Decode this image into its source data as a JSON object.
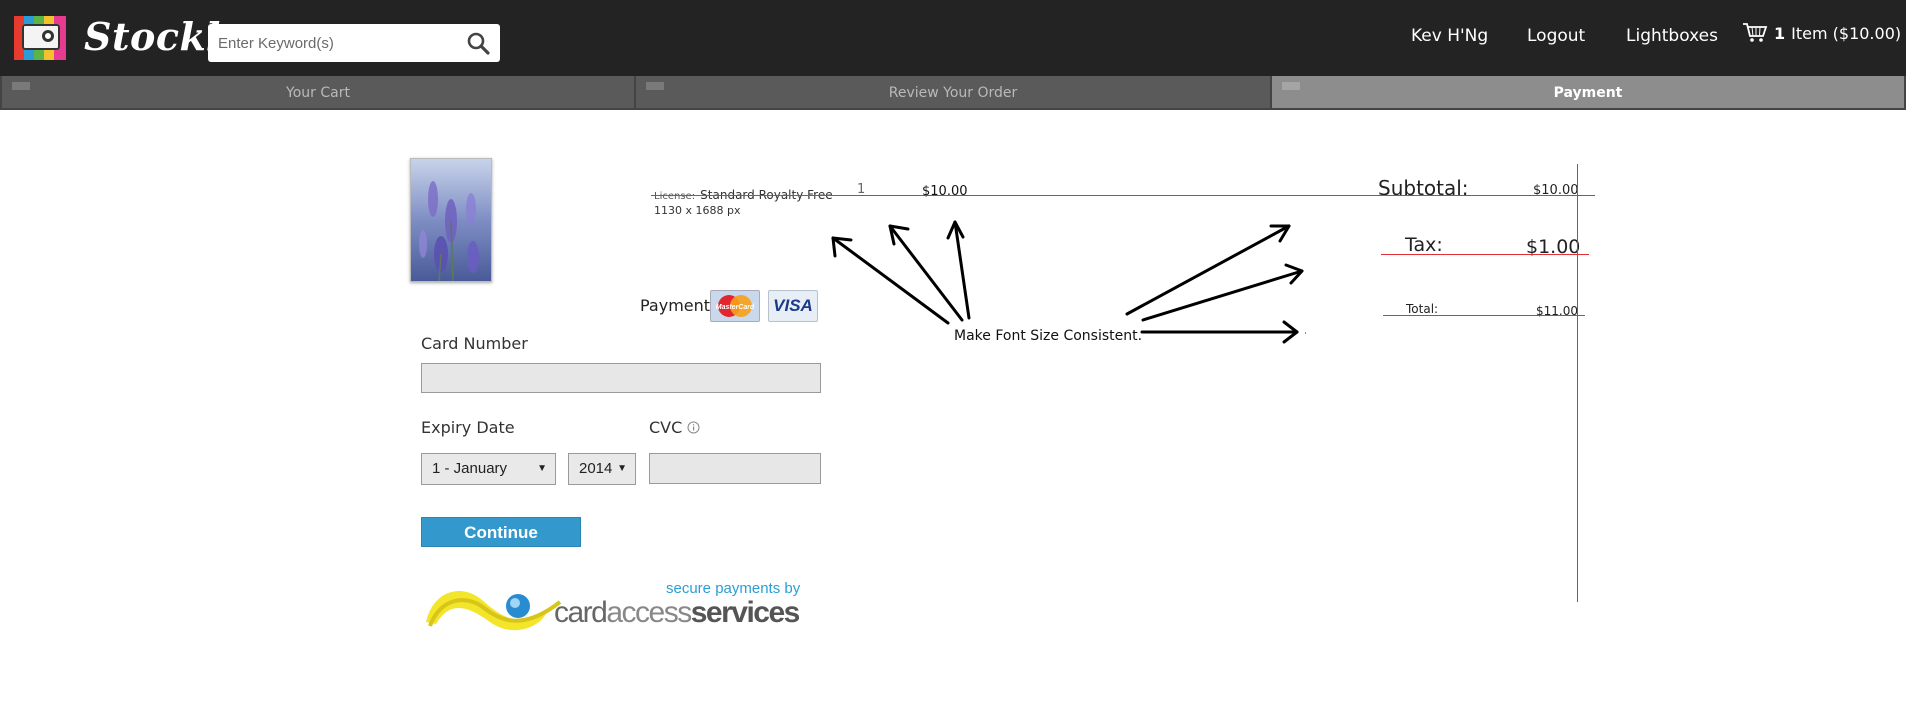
{
  "header": {
    "brand": "Stockbo",
    "search_placeholder": "Enter Keyword(s)",
    "nav": {
      "user": "Kev H'Ng",
      "logout": "Logout",
      "lightboxes": "Lightboxes"
    },
    "cart": {
      "count": "1",
      "summary": "Item ($10.00)"
    }
  },
  "steps": [
    {
      "label": "Your Cart"
    },
    {
      "label": "Review Your Order"
    },
    {
      "label": "Payment",
      "active": true
    }
  ],
  "product": {
    "license_prefix": "License:",
    "license": "Standard Royalty Free",
    "dimensions": "1130 x 1688 px",
    "quantity": "1",
    "price": "$10.00"
  },
  "totals": {
    "subtotal_label": "Subtotal:",
    "subtotal_value": "$10.00",
    "tax_label": "Tax:",
    "tax_value": "$1.00",
    "total_label": "Total:",
    "total_value": "$11.00"
  },
  "payment": {
    "title": "Payment",
    "card_number_label": "Card Number",
    "card_number_value": "",
    "expiry_label": "Expiry Date",
    "expiry_month": "1 - January",
    "expiry_year": "2014",
    "cvc_label": "CVC",
    "cvc_value": "",
    "continue_label": "Continue",
    "mastercard_text": "MasterCard",
    "visa_text": "VISA"
  },
  "provider": {
    "tagline": "secure payments by",
    "name_part1": "card",
    "name_part2": "access",
    "name_part3": "services"
  },
  "annotation": {
    "text": "Make Font Size Consistent."
  },
  "colors": {
    "topbar": "#232323",
    "accent": "#3399cc",
    "redline": "#e0303a"
  }
}
